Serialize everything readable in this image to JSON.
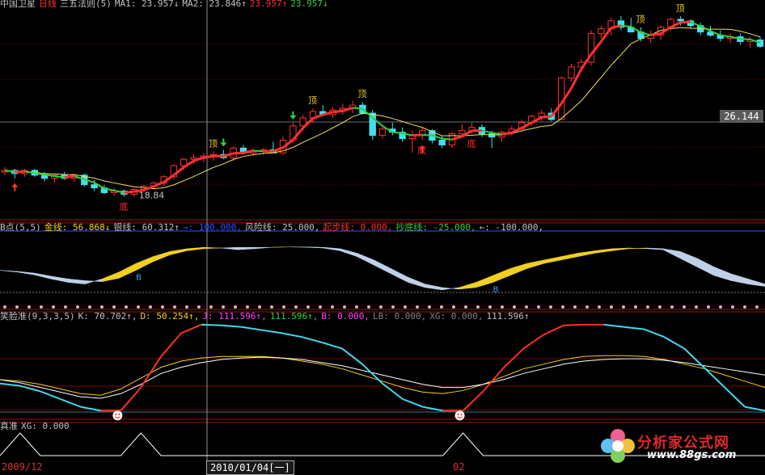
{
  "colors": {
    "bg": "#000000",
    "up": "#ff3030",
    "down": "#40e0f0",
    "grid": "#7a0000",
    "yellow": "#f0d020",
    "lightblue": "#c0d0e8",
    "red": "#ff3020",
    "cyan": "#40d8f0",
    "white": "#ffffff",
    "green": "#30d040",
    "magenta": "#ff40ff"
  },
  "panel1": {
    "items": [
      {
        "t": "中国卫星",
        "c": "#c0c0c0"
      },
      {
        "t": "日线",
        "c": "#ff3030"
      },
      {
        "t": "三五法则(5)",
        "c": "#c0c0c0"
      },
      {
        "t": "MA1: 23.957↓",
        "c": "#c0c0c0"
      },
      {
        "t": "MA2: 23.846↑",
        "c": "#c0c0c0"
      },
      {
        "t": "23.957↑",
        "c": "#ff3030"
      },
      {
        "t": "23.957↓",
        "c": "#30d040"
      }
    ],
    "price_tag": "26.144",
    "low_label": "18.84",
    "top_label": "顶",
    "bottom_label": "底"
  },
  "panel2": {
    "items": [
      {
        "t": "B点(5,5)",
        "c": "#c0c0c0"
      },
      {
        "t": "金线: 56.868↓",
        "c": "#f0d020"
      },
      {
        "t": "银线: 60.312↑",
        "c": "#c0c0c0"
      },
      {
        "t": "→: 100.000,",
        "c": "#3050ff"
      },
      {
        "t": "风险线: 25.000,",
        "c": "#c0c0c0"
      },
      {
        "t": "起步线: 0.000,",
        "c": "#ff3030"
      },
      {
        "t": "抄底线: -25.000,",
        "c": "#30d040"
      },
      {
        "t": "←: -100.000,",
        "c": "#c0c0c0"
      }
    ],
    "b_label": "B"
  },
  "panel3": {
    "items": [
      {
        "t": "笑脸准(9,3,3,5)",
        "c": "#c0c0c0"
      },
      {
        "t": "K: 70.702↑,",
        "c": "#c0c0c0"
      },
      {
        "t": "D: 50.254↑,",
        "c": "#f0d020"
      },
      {
        "t": "J: 111.596↑,",
        "c": "#ff40ff"
      },
      {
        "t": "111.596↑,",
        "c": "#30d040"
      },
      {
        "t": "B: 0.000,",
        "c": "#ff40ff"
      },
      {
        "t": "LB: 0.000,",
        "c": "#808080"
      },
      {
        "t": "XG: 0.000,",
        "c": "#808080"
      },
      {
        "t": "111.596↑",
        "c": "#c0c0c0"
      }
    ]
  },
  "panel4": {
    "items": [
      {
        "t": "真准",
        "c": "#c0c0c0"
      },
      {
        "t": "XG: 0.000",
        "c": "#c0c0c0"
      }
    ]
  },
  "dates": {
    "left": "2009/12",
    "cursor": "2010/01/04[一]",
    "mid": "02"
  },
  "logo": {
    "text": "分析家公式网",
    "url": "www.88gs.com"
  },
  "chart_data": [
    {
      "type": "candlestick",
      "title": "中国卫星 日线",
      "ylim": [
        17.5,
        30.5
      ],
      "price_marker": 26.144,
      "low_marker": 18.84,
      "candles": [
        [
          20.4,
          20.7,
          20.2,
          20.5
        ],
        [
          20.5,
          20.6,
          20.0,
          20.3
        ],
        [
          20.3,
          20.6,
          20.1,
          20.5
        ],
        [
          20.5,
          20.6,
          20.1,
          20.2
        ],
        [
          20.2,
          20.4,
          19.8,
          20.0
        ],
        [
          20.0,
          20.3,
          19.7,
          20.2
        ],
        [
          20.2,
          20.4,
          19.9,
          20.0
        ],
        [
          20.0,
          20.3,
          19.8,
          20.2
        ],
        [
          20.2,
          20.3,
          19.5,
          19.6
        ],
        [
          19.6,
          19.9,
          19.2,
          19.4
        ],
        [
          19.4,
          19.6,
          19.0,
          19.1
        ],
        [
          19.1,
          19.4,
          18.9,
          19.2
        ],
        [
          19.2,
          19.3,
          18.85,
          19.0
        ],
        [
          19.0,
          19.4,
          18.84,
          19.3
        ],
        [
          19.3,
          19.6,
          19.1,
          19.5
        ],
        [
          19.5,
          19.8,
          19.3,
          19.7
        ],
        [
          19.7,
          20.2,
          19.5,
          20.1
        ],
        [
          20.1,
          20.9,
          19.9,
          20.8
        ],
        [
          20.8,
          21.3,
          20.5,
          21.2
        ],
        [
          21.2,
          21.5,
          20.9,
          21.3
        ],
        [
          21.3,
          21.6,
          21.0,
          21.4
        ],
        [
          21.4,
          21.7,
          21.1,
          21.5
        ],
        [
          21.5,
          21.8,
          21.2,
          21.3
        ],
        [
          21.3,
          22.0,
          21.1,
          21.9
        ],
        [
          21.9,
          22.1,
          21.5,
          21.6
        ],
        [
          21.6,
          21.9,
          21.4,
          21.7
        ],
        [
          21.7,
          21.9,
          21.5,
          21.8
        ],
        [
          21.8,
          22.3,
          21.6,
          21.6
        ],
        [
          21.6,
          22.6,
          21.5,
          22.4
        ],
        [
          22.4,
          23.5,
          22.2,
          23.3
        ],
        [
          23.3,
          24.0,
          23.0,
          23.8
        ],
        [
          23.8,
          24.4,
          23.5,
          24.2
        ],
        [
          24.2,
          24.6,
          23.9,
          24.0
        ],
        [
          24.0,
          24.5,
          23.8,
          24.3
        ],
        [
          24.3,
          24.7,
          24.0,
          24.4
        ],
        [
          24.4,
          24.9,
          24.1,
          24.6
        ],
        [
          24.6,
          24.8,
          24.0,
          24.1
        ],
        [
          24.1,
          24.3,
          22.4,
          22.7
        ],
        [
          22.7,
          23.3,
          22.5,
          23.1
        ],
        [
          23.1,
          23.5,
          22.7,
          22.9
        ],
        [
          22.9,
          23.2,
          22.3,
          22.5
        ],
        [
          22.5,
          23.0,
          21.6,
          22.7
        ],
        [
          22.7,
          23.2,
          22.4,
          23.0
        ],
        [
          23.0,
          23.1,
          22.2,
          22.4
        ],
        [
          22.4,
          22.7,
          21.9,
          22.1
        ],
        [
          22.1,
          22.9,
          21.9,
          22.8
        ],
        [
          22.8,
          23.4,
          22.6,
          23.0
        ],
        [
          23.0,
          23.5,
          22.8,
          23.2
        ],
        [
          23.2,
          23.4,
          22.6,
          22.8
        ],
        [
          22.8,
          23.0,
          21.9,
          22.6
        ],
        [
          22.6,
          23.0,
          22.3,
          22.9
        ],
        [
          22.9,
          23.3,
          22.7,
          23.1
        ],
        [
          23.1,
          23.7,
          22.9,
          23.5
        ],
        [
          23.5,
          24.0,
          23.3,
          23.9
        ],
        [
          23.9,
          24.3,
          23.6,
          24.1
        ],
        [
          24.1,
          24.4,
          23.6,
          23.7
        ],
        [
          23.7,
          26.4,
          23.7,
          26.3
        ],
        [
          26.3,
          27.2,
          26.1,
          27.0
        ],
        [
          27.0,
          27.5,
          26.7,
          27.3
        ],
        [
          27.3,
          29.3,
          27.1,
          29.1
        ],
        [
          29.1,
          29.6,
          28.8,
          29.4
        ],
        [
          29.4,
          30.1,
          29.0,
          29.9
        ],
        [
          29.9,
          30.2,
          29.3,
          29.5
        ],
        [
          29.5,
          30.1,
          29.2,
          29.2
        ],
        [
          29.2,
          29.5,
          28.6,
          28.8
        ],
        [
          28.8,
          29.3,
          28.5,
          29.0
        ],
        [
          29.0,
          29.6,
          28.7,
          29.5
        ],
        [
          29.5,
          30.1,
          29.3,
          30.0
        ],
        [
          30.0,
          30.2,
          29.6,
          29.9
        ],
        [
          29.9,
          30.0,
          29.4,
          29.6
        ],
        [
          29.6,
          29.8,
          29.0,
          29.2
        ],
        [
          29.2,
          29.6,
          28.9,
          29.0
        ],
        [
          29.0,
          29.3,
          28.6,
          28.8
        ],
        [
          28.8,
          29.1,
          28.5,
          28.9
        ],
        [
          28.9,
          29.1,
          28.4,
          28.6
        ],
        [
          28.6,
          28.9,
          28.2,
          28.7
        ],
        [
          28.7,
          28.9,
          28.2,
          28.3
        ]
      ]
    },
    {
      "type": "area",
      "title": "B点(5,5)",
      "ylim": [
        -100,
        100
      ],
      "series": [
        {
          "name": "金线",
          "values": [
            -5,
            -10,
            -18,
            -30,
            -40,
            -45,
            -30,
            -10,
            15,
            35,
            50,
            58,
            62,
            60,
            55,
            58,
            62,
            63,
            62,
            60,
            52,
            35,
            10,
            -15,
            -40,
            -55,
            -62,
            -55,
            -40,
            -20,
            0,
            15,
            25,
            35,
            45,
            52,
            58,
            60,
            58,
            55,
            30,
            5,
            -20,
            -35,
            -45,
            -52
          ]
        },
        {
          "name": "银线",
          "values": [
            -5,
            -8,
            -13,
            -22,
            -30,
            -35,
            -38,
            -28,
            -5,
            20,
            40,
            52,
            58,
            60,
            62,
            62,
            62,
            63,
            63,
            62,
            58,
            45,
            25,
            0,
            -25,
            -45,
            -55,
            -60,
            -55,
            -40,
            -20,
            0,
            15,
            25,
            35,
            45,
            52,
            58,
            60,
            58,
            50,
            30,
            5,
            -15,
            -30,
            -45
          ]
        }
      ],
      "signals": [
        "B",
        "B"
      ]
    },
    {
      "type": "line",
      "title": "笑脸准(9,3,3,5)",
      "ylim": [
        -10,
        115
      ],
      "series": [
        {
          "name": "K",
          "values": [
            35,
            32,
            25,
            15,
            5,
            0,
            0,
            30,
            70,
            100,
            111,
            110,
            108,
            104,
            100,
            95,
            88,
            80,
            60,
            35,
            15,
            5,
            0,
            0,
            25,
            55,
            80,
            98,
            110,
            111,
            111,
            108,
            105,
            95,
            80,
            55,
            30,
            5,
            0
          ]
        },
        {
          "name": "D",
          "values": [
            40,
            38,
            34,
            28,
            22,
            20,
            28,
            42,
            56,
            64,
            68,
            70,
            70,
            70,
            68,
            64,
            60,
            54,
            46,
            38,
            30,
            24,
            22,
            26,
            34,
            44,
            54,
            60,
            66,
            70,
            71,
            71,
            70,
            66,
            60,
            54,
            46,
            38,
            30
          ]
        },
        {
          "name": "J",
          "values": [
            40,
            36,
            30,
            24,
            18,
            16,
            22,
            34,
            48,
            56,
            62,
            66,
            68,
            69,
            68,
            66,
            62,
            58,
            52,
            46,
            40,
            34,
            30,
            30,
            34,
            40,
            48,
            54,
            60,
            64,
            66,
            67,
            67,
            65,
            62,
            58,
            54,
            50,
            46
          ]
        }
      ]
    },
    {
      "type": "line",
      "title": "真准",
      "series": [
        {
          "name": "XG",
          "values": [
            0,
            1,
            0,
            0,
            0,
            0,
            0,
            1,
            0,
            0,
            0,
            0,
            0,
            0,
            0,
            0,
            0,
            0,
            0,
            0,
            0,
            0,
            0,
            1,
            0,
            0,
            0,
            0,
            0,
            0,
            0,
            0,
            0,
            0,
            0,
            0,
            0,
            0,
            0
          ]
        }
      ]
    }
  ]
}
